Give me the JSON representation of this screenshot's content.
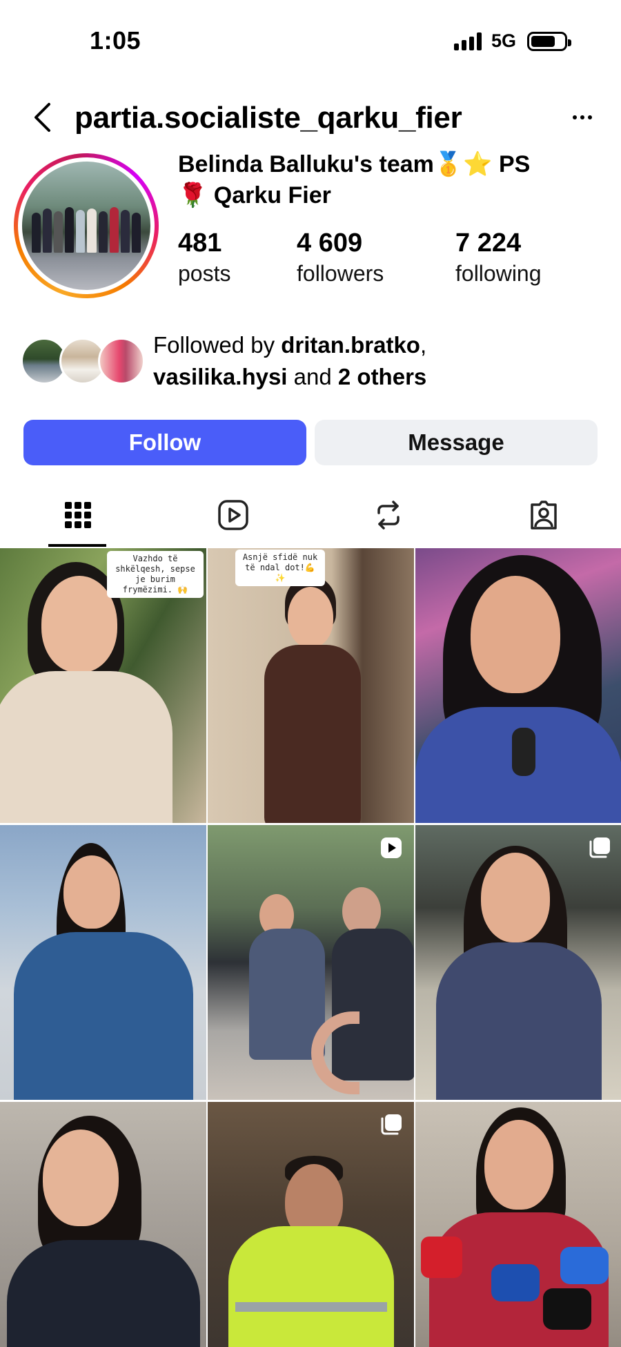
{
  "status_bar": {
    "time": "1:05",
    "network": "5G",
    "battery_level": 0.74,
    "signal_bars": 4
  },
  "header": {
    "username": "partia.socialiste_qarku_fier",
    "back_icon": "chevron-left-icon",
    "more_icon": "ellipsis-icon"
  },
  "profile": {
    "bio_line1": "Belinda Balluku's team🥇⭐ PS",
    "bio_line2": "🌹 Qarku Fier",
    "stats": [
      {
        "value": "481",
        "label": "posts"
      },
      {
        "value": "4 609",
        "label": "followers"
      },
      {
        "value": "7 224",
        "label": "following"
      }
    ]
  },
  "followed_by": {
    "prefix": "Followed by ",
    "user1": "dritan.bratko",
    "sep": ",",
    "user2": "vasilika.hysi",
    "mid": " and ",
    "others": "2 others"
  },
  "actions": {
    "follow": "Follow",
    "message": "Message"
  },
  "tabs": [
    {
      "name": "grid-icon",
      "active": true
    },
    {
      "name": "reels-icon",
      "active": false
    },
    {
      "name": "reposts-icon",
      "active": false
    },
    {
      "name": "tagged-icon",
      "active": false
    }
  ],
  "posts": [
    {
      "caption": "Vazhdo të shkëlqesh, sepse je burim frymëzimi. 🙌",
      "badge": ""
    },
    {
      "caption": "Asnjë sfidë nuk të ndal dot!💪✨",
      "badge": ""
    },
    {
      "caption": "",
      "badge": ""
    },
    {
      "caption": "",
      "badge": ""
    },
    {
      "caption": "",
      "badge": "reel-icon"
    },
    {
      "caption": "",
      "badge": "carousel-icon"
    },
    {
      "caption": "",
      "badge": ""
    },
    {
      "caption": "",
      "badge": "carousel-icon"
    },
    {
      "caption": "",
      "badge": ""
    }
  ],
  "colors": {
    "follow_button": "#4a5df9",
    "message_button": "#eef0f3",
    "story_ring": [
      "#f9a825",
      "#e91e63",
      "#d500f9"
    ]
  }
}
